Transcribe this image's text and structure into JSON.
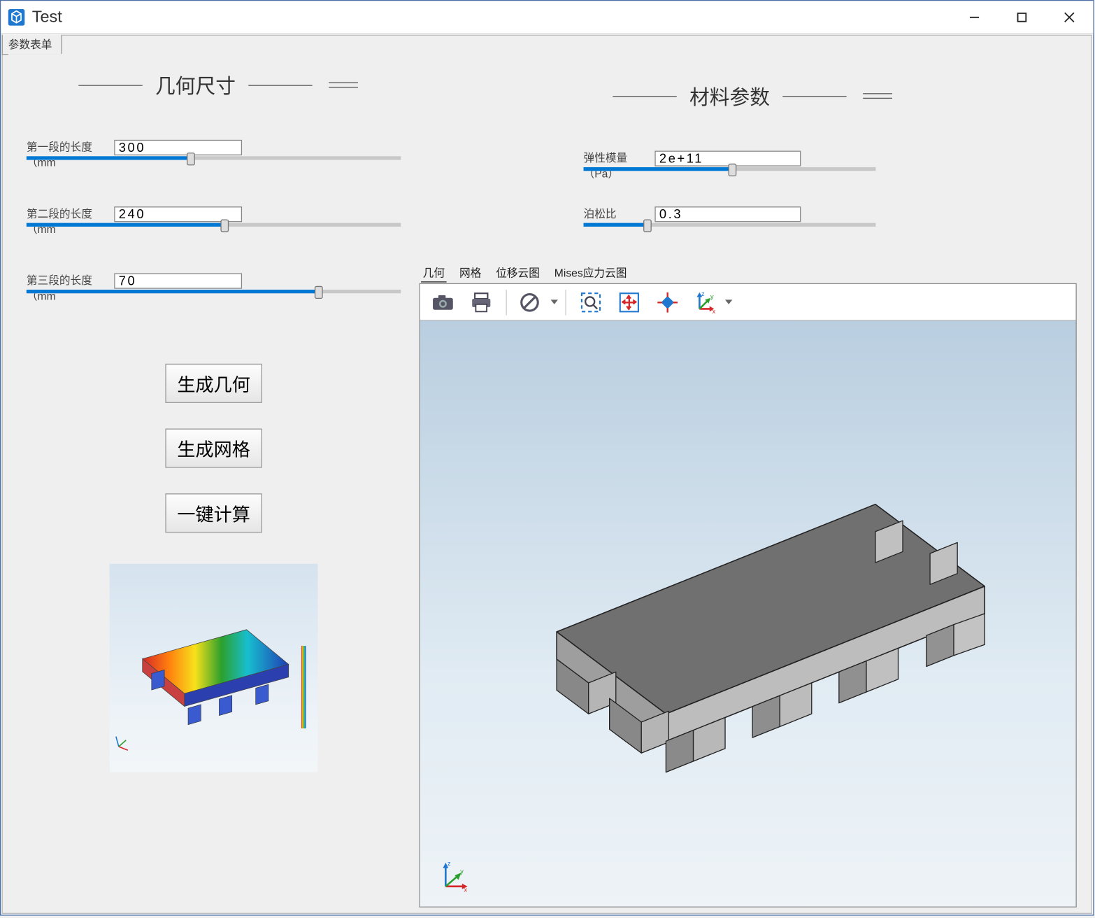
{
  "window": {
    "title": "Test"
  },
  "tabs": {
    "param_tab": "参数表单"
  },
  "sections": {
    "geometry_title": "几何尺寸",
    "material_title": "材料参数"
  },
  "geometry": {
    "len1": {
      "label": "第一段的长度（mm",
      "value": "300",
      "fill_pct": 44,
      "thumb_pct": 44
    },
    "len2": {
      "label": "第二段的长度（mm",
      "value": "240",
      "fill_pct": 53,
      "thumb_pct": 53
    },
    "len3": {
      "label": "第三段的长度（mm",
      "value": "70",
      "fill_pct": 78,
      "thumb_pct": 78
    }
  },
  "material": {
    "young": {
      "label": "弹性模量（Pa）",
      "value": "2e+11",
      "fill_pct": 51,
      "thumb_pct": 51
    },
    "poisson": {
      "label": "泊松比",
      "value": "0.3",
      "fill_pct": 22,
      "thumb_pct": 22
    }
  },
  "buttons": {
    "gen_geometry": "生成几何",
    "gen_mesh": "生成网格",
    "one_click_solve": "一键计算"
  },
  "viewer_tabs": {
    "geom": "几何",
    "mesh": "网格",
    "disp": "位移云图",
    "mises": "Mises应力云图"
  },
  "axes": {
    "x": "x",
    "y": "y",
    "z": "z"
  }
}
